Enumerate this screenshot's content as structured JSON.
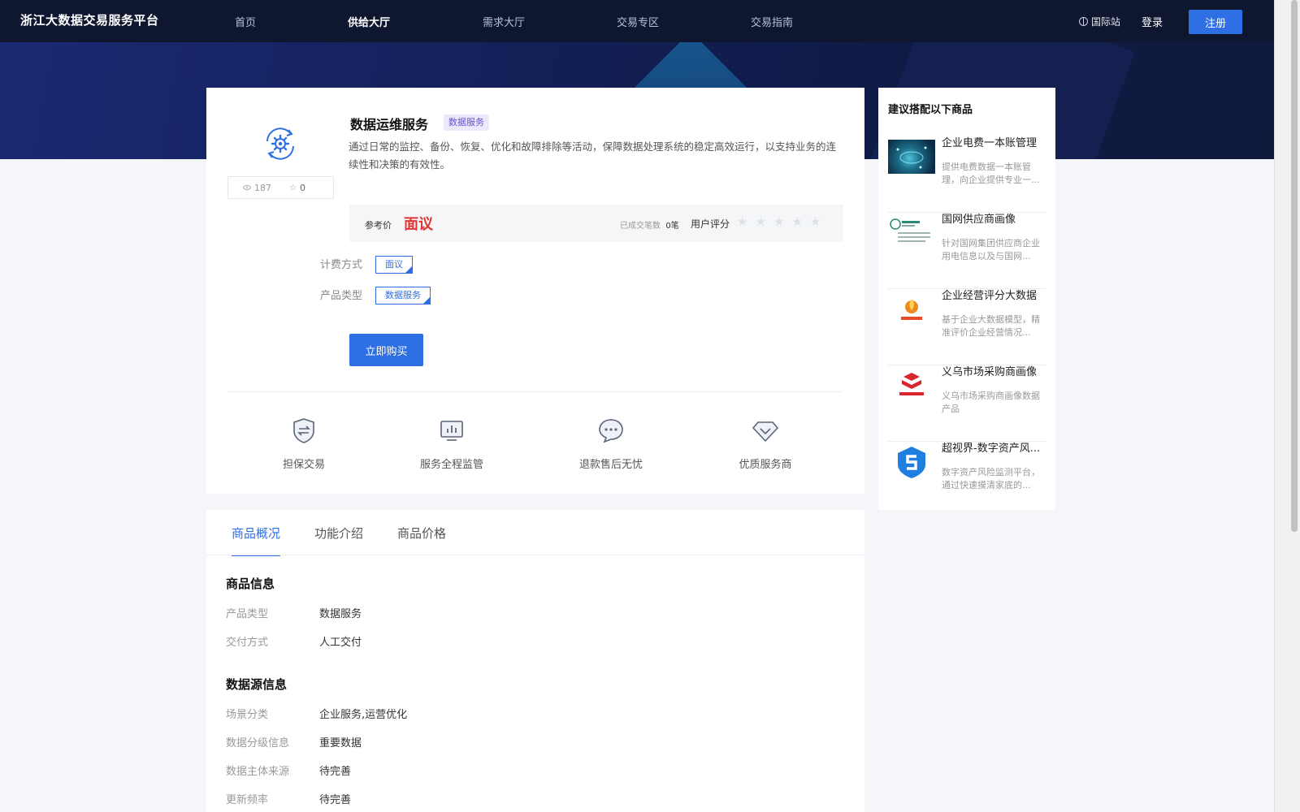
{
  "header": {
    "brand": "浙江大数据交易服务平台",
    "nav": [
      "首页",
      "供给大厅",
      "需求大厅",
      "交易专区",
      "交易指南"
    ],
    "active_nav": "供给大厅",
    "intl": "国际站",
    "login": "登录",
    "register": "注册"
  },
  "product": {
    "title": "数据运维服务",
    "tag": "数据服务",
    "description": "通过日常的监控、备份、恢复、优化和故障排除等活动，保障数据处理系统的稳定高效运行，以支持业务的连续性和决策的有效性。",
    "views": "187",
    "favorites": "0",
    "price_label": "参考价",
    "price": "面议",
    "deals_label": "已成交笔数",
    "deals_value": "0笔",
    "rating_label": "用户评分",
    "rating_stars": "★★★★★",
    "rating_value": 0,
    "billing_label": "计费方式",
    "billing_option": "面议",
    "type_label": "产品类型",
    "type_option": "数据服务",
    "buy": "立即购买",
    "features": [
      "担保交易",
      "服务全程监管",
      "退款售后无忧",
      "优质服务商"
    ]
  },
  "tabs": {
    "items": [
      "商品概况",
      "功能介绍",
      "商品价格"
    ],
    "active": "商品概况"
  },
  "overview": {
    "goods_info_title": "商品信息",
    "goods_info": [
      {
        "key": "产品类型",
        "value": "数据服务"
      },
      {
        "key": "交付方式",
        "value": "人工交付"
      }
    ],
    "source_info_title": "数据源信息",
    "source_info": [
      {
        "key": "场景分类",
        "value": "企业服务,运营优化"
      },
      {
        "key": "数据分级信息",
        "value": "重要数据"
      },
      {
        "key": "数据主体来源",
        "value": "待完善"
      },
      {
        "key": "更新频率",
        "value": "待完善"
      }
    ]
  },
  "sidebar": {
    "title": "建议搭配以下商品",
    "items": [
      {
        "title": "企业电费一本账管理",
        "desc": "提供电费数据一本账管理，向企业提供专业一..."
      },
      {
        "title": "国网供应商画像",
        "desc": "针对国网集团供应商企业用电信息以及与国网..."
      },
      {
        "title": "企业经营评分大数据",
        "desc": "基于企业大数据模型，精准评价企业经营情况..."
      },
      {
        "title": "义乌市场采购商画像",
        "desc": "义乌市场采购商画像数据产品"
      },
      {
        "title": "超视界-数字资产风...",
        "desc": "数字资产风险监测平台，通过快速摸清家底的..."
      }
    ]
  },
  "colors": {
    "primary": "#2f6fe4",
    "price_red": "#e23636",
    "header_bg": "#0f1730",
    "tag_purple": "#6a4fd8"
  }
}
